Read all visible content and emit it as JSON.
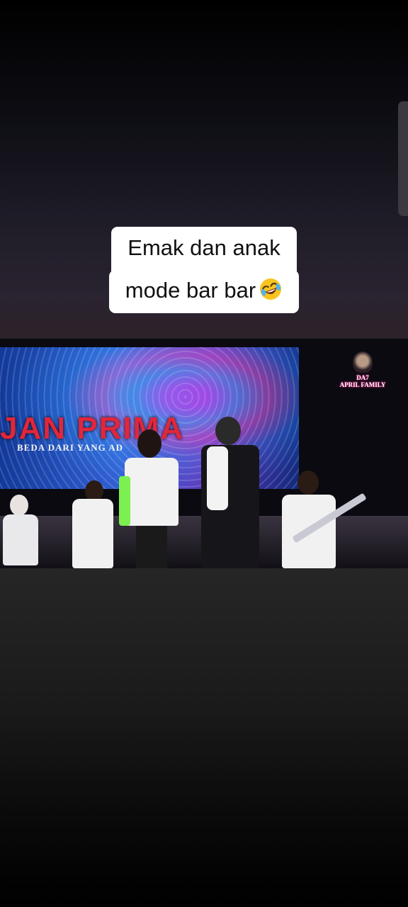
{
  "caption": {
    "line1": "Emak dan anak",
    "line2": "mode bar bar",
    "emoji": "rolling-on-floor-laughing-emoji"
  },
  "video": {
    "screen_title": "JAN PRIMA",
    "screen_subtitle": "BEDA DARI YANG AD",
    "logo_line1": "DA7",
    "logo_line2": "APRIL FAMILY"
  },
  "colors": {
    "caption_bg": "#ffffff",
    "caption_text": "#111111",
    "screen_title": "#e1263b",
    "logo_glow": "#d0167a"
  }
}
